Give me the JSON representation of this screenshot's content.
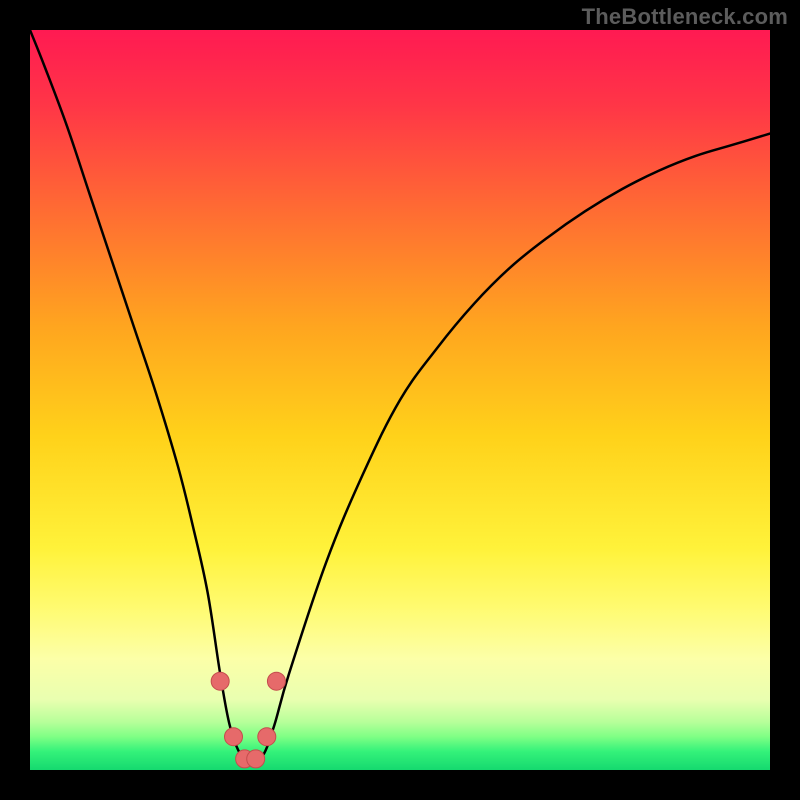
{
  "watermark": "TheBottleneck.com",
  "colors": {
    "black": "#000000",
    "curve_stroke": "#000000",
    "marker_fill": "#e66a6a",
    "marker_stroke": "#c44d4d",
    "gradient_stops": [
      {
        "offset": 0,
        "color": "#ff1a52"
      },
      {
        "offset": 0.1,
        "color": "#ff3547"
      },
      {
        "offset": 0.25,
        "color": "#ff6e32"
      },
      {
        "offset": 0.4,
        "color": "#ffa51f"
      },
      {
        "offset": 0.55,
        "color": "#ffd21a"
      },
      {
        "offset": 0.7,
        "color": "#fff23a"
      },
      {
        "offset": 0.78,
        "color": "#fffb70"
      },
      {
        "offset": 0.85,
        "color": "#fcffa8"
      },
      {
        "offset": 0.905,
        "color": "#e9ffb0"
      },
      {
        "offset": 0.935,
        "color": "#b7ff9a"
      },
      {
        "offset": 0.955,
        "color": "#7fff85"
      },
      {
        "offset": 0.975,
        "color": "#34f27a"
      },
      {
        "offset": 1.0,
        "color": "#15d96f"
      }
    ]
  },
  "chart_data": {
    "type": "line",
    "title": "",
    "xlabel": "",
    "ylabel": "",
    "xlim": [
      0,
      100
    ],
    "ylim": [
      0,
      100
    ],
    "grid": false,
    "series": [
      {
        "name": "bottleneck-curve",
        "x": [
          0,
          2,
          5,
          8,
          11,
          14,
          17,
          20,
          22,
          24,
          25.7,
          27,
          28.5,
          30,
          31.5,
          33,
          35,
          40,
          45,
          50,
          55,
          60,
          65,
          70,
          75,
          80,
          85,
          90,
          95,
          100
        ],
        "values": [
          100,
          95,
          87,
          78,
          69,
          60,
          51,
          41,
          33,
          24,
          13,
          6,
          2,
          1,
          2,
          6,
          13,
          28,
          40,
          50,
          57,
          63,
          68,
          72,
          75.5,
          78.5,
          81,
          83,
          84.5,
          86
        ]
      }
    ],
    "markers": {
      "name": "bottleneck-valley-markers",
      "x": [
        25.7,
        27.5,
        29,
        30.5,
        32,
        33.3
      ],
      "values": [
        12,
        4.5,
        1.5,
        1.5,
        4.5,
        12
      ]
    }
  }
}
